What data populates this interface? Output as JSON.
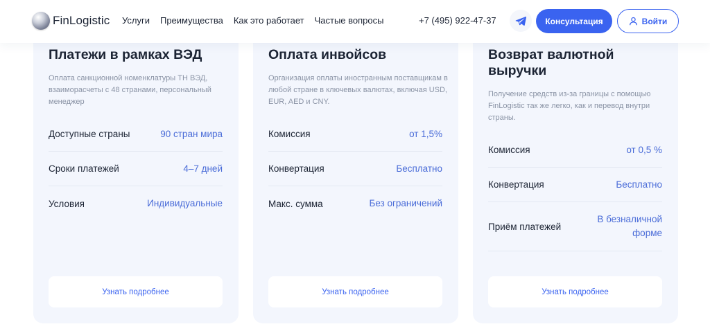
{
  "header": {
    "brand": "FinLogistic",
    "nav": [
      "Услуги",
      "Преимущества",
      "Как это работает",
      "Частые вопросы"
    ],
    "phone": "+7 (495) 922-47-37",
    "telegram_icon": "telegram-icon",
    "consult_label": "Консультация",
    "login_label": "Войти",
    "accent_color": "#3a63f0"
  },
  "cards": [
    {
      "title": "Платежи в рамках ВЭД",
      "description": "Оплата санкционной номенклатуры ТН ВЭД, взаиморасчеты с 48 странами, персональный менеджер",
      "rows": [
        {
          "label": "Доступные страны",
          "value": "90 стран мира"
        },
        {
          "label": "Сроки платежей",
          "value": "4–7 дней"
        },
        {
          "label": "Условия",
          "value": "Индивидуальные"
        }
      ],
      "more_label": "Узнать подробнее"
    },
    {
      "title": "Оплата инвойсов",
      "description": "Организация оплаты иностранным поставщикам в любой стране в ключевых валютах, включая USD, EUR, AED и CNY.",
      "rows": [
        {
          "label": "Комиссия",
          "value": "от 1,5%"
        },
        {
          "label": "Конвертация",
          "value": "Бесплатно"
        },
        {
          "label": "Макс. сумма",
          "value": "Без ограничений"
        }
      ],
      "more_label": "Узнать подробнее"
    },
    {
      "title": "Возврат валютной выручки",
      "description": "Получение средств из-за границы с помощью FinLogistic так же легко, как и перевод внутри страны.",
      "rows": [
        {
          "label": "Комиссия",
          "value": "от 0,5 %"
        },
        {
          "label": "Конвертация",
          "value": "Бесплатно"
        },
        {
          "label": "Приём платежей",
          "value": "В безналичной форме"
        }
      ],
      "more_label": "Узнать подробнее"
    }
  ]
}
